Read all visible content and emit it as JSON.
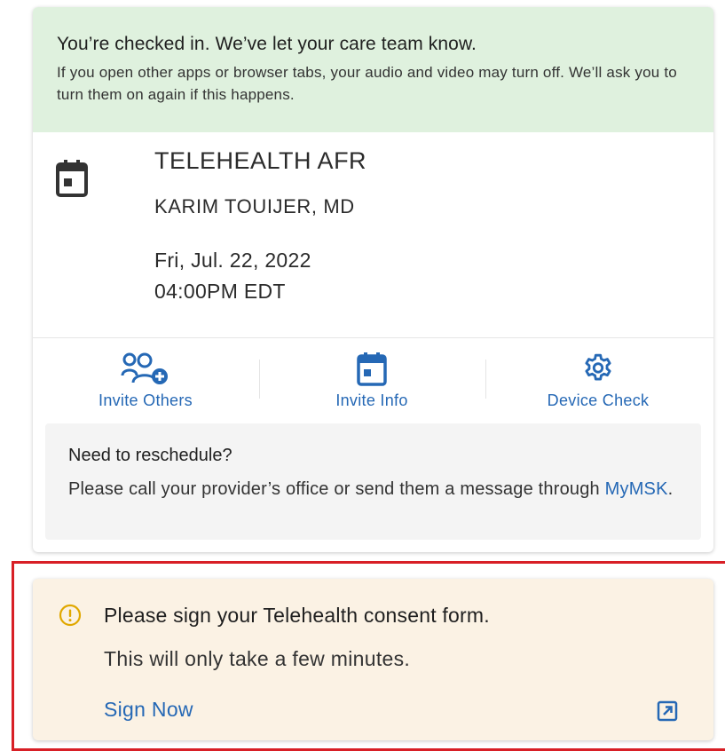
{
  "banner": {
    "title": "You’re checked in. We’ve let your care team know.",
    "body": "If you open other apps or browser tabs, your audio and video may turn off. We’ll ask you to turn them on again if this happens."
  },
  "appointment": {
    "icon": "calendar-icon",
    "title": "TELEHEALTH AFR",
    "provider": "KARIM TOUIJER, MD",
    "date": "Fri, Jul. 22, 2022",
    "time": "04:00PM EDT"
  },
  "actions": [
    {
      "label": "Invite Others",
      "icon": "people-add-icon"
    },
    {
      "label": "Invite Info",
      "icon": "calendar-icon"
    },
    {
      "label": "Device Check",
      "icon": "gear-icon"
    }
  ],
  "reschedule": {
    "title": "Need to reschedule?",
    "body_prefix": "Please call your provider’s office or send them a message through ",
    "link": "MyMSK",
    "body_suffix": "."
  },
  "consent": {
    "title": "Please sign your Telehealth consent form.",
    "body": "This will only take a few minutes.",
    "link": "Sign Now",
    "icon": "warning-circle-icon",
    "link_icon": "external-link-icon"
  },
  "colors": {
    "accent": "#2568b5",
    "banner_bg": "#dff1de",
    "consent_bg": "#fbf2e4",
    "warning": "#e0a800",
    "highlight": "#d81f26"
  }
}
